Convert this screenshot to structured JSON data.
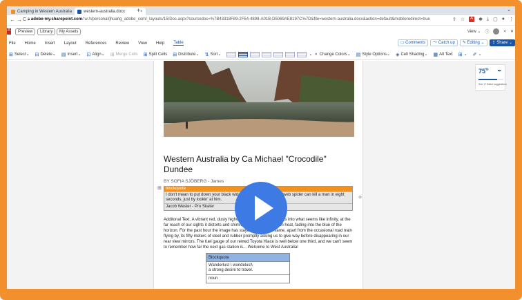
{
  "browser": {
    "tabs": [
      {
        "title": "Camping in Western Australia",
        "close": "×"
      },
      {
        "title": "western-australia.docx",
        "close": "×"
      }
    ],
    "new_tab": "+",
    "back": "←",
    "forward": "→",
    "reload": "C",
    "url_host": "adobe-my.sharepoint.com",
    "url_rest": "/:w:/r/personal/jhuang_adobe_com/_layouts/15/Doc.aspx?sourcedoc=%7B43318F89-2F54-4898-A01B-D5069AE8197C%7D&file=western-australia.docx&action=default&mobileredirect=true"
  },
  "breadcrumbs": {
    "app_letter": "A",
    "items": [
      "Preview",
      "Library",
      "My Assets"
    ],
    "view_label": "View"
  },
  "menu": {
    "items": [
      "File",
      "Home",
      "Insert",
      "Layout",
      "References",
      "Review",
      "View",
      "Help",
      "Table"
    ],
    "active": "Table",
    "comments": "Comments",
    "catchup": "Catch up",
    "editing": "Editing",
    "share": "Share"
  },
  "toolbar": {
    "select": "Select",
    "delete": "Delete",
    "insert": "Insert",
    "align": "Align",
    "merge": "Merge Cells",
    "split": "Split Cells",
    "distribute": "Distribute",
    "sort": "Sort",
    "change_colors": "Change Colors",
    "style_options": "Style Options",
    "cell_shading": "Cell Shading",
    "alt_text": "Alt Text"
  },
  "editor": {
    "score": "75",
    "score_unit": "%",
    "score_fraction": 0.75,
    "subtitle": "See 17 Editor suggestions"
  },
  "document": {
    "title": "Western Australia by Ca                Michael \"Crocodile\" Dundee",
    "byline": "BY SOFIA SJÖBERG - James",
    "blockquote_header": "blockquote",
    "blockquote_text": "I don't mean to put down your black widow spider, but the funnelweb spider can kill a man in eight seconds, just by lookin' at him.",
    "blockquote_author": "Jacob Wester - Pro Skater",
    "paragraph": "Additonal Text. A vibrant red, dusty highway stretches out before us into what seems like infinity, at the far reach of our sights it distorts and shimmers from the afternoon heat, fading into the blue of the horizon. For the past hour the image has stayed roughly the same, apart from the occasional road train flying by, its fifty meters of steel and rubber promptly asking us to give way before disappearing in our rear view mirrors. The fuel gauge of our rented Toyota Hiace is well below one third, and we can't seem to remember how far the next gas station is... Welcome to West Australia!",
    "table2": {
      "header": "Blockquote",
      "row1_line1": "Wanderlust \\ wondelust\\",
      "row1_line2": "a strong desire to travel.",
      "row2": "noun"
    }
  }
}
